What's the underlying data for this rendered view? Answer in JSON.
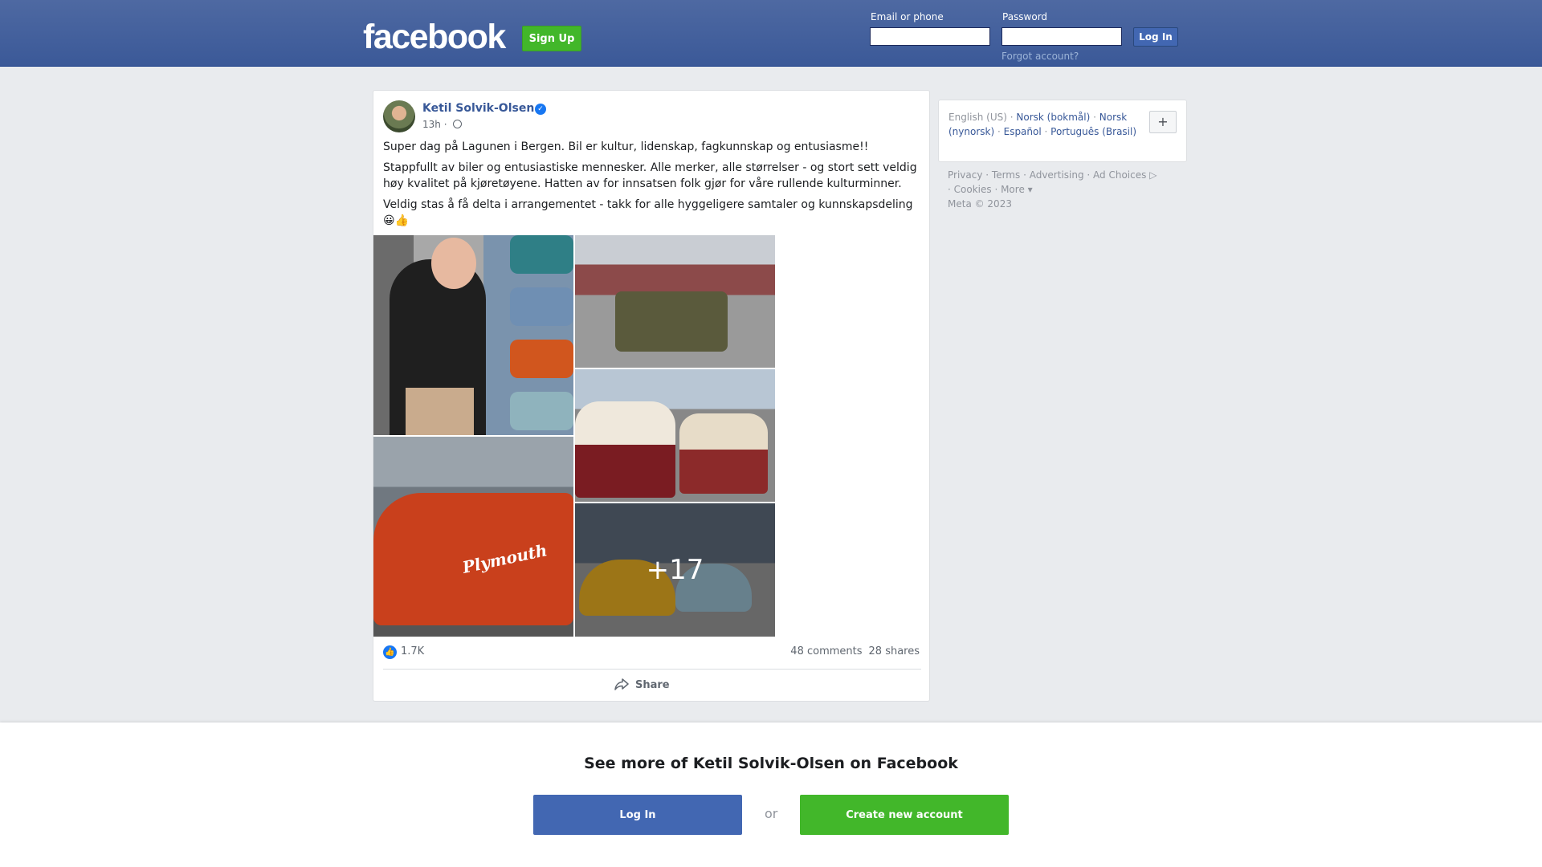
{
  "header": {
    "logo": "facebook",
    "signup_label": "Sign Up",
    "email_label": "Email or phone",
    "password_label": "Password",
    "login_label": "Log In",
    "forgot_label": "Forgot account?"
  },
  "post": {
    "author": "Ketil Solvik-Olsen",
    "time": "13h",
    "privacy_icon": "globe-icon",
    "paragraphs": [
      "Super dag på Lagunen i Bergen. Bil er kultur, lidenskap, fagkunnskap og entusiasme!!",
      "Stappfullt av biler og entusiastiske mennesker. Alle merker, alle størrelser - og stort sett veldig høy kvalitet på kjøretøyene. Hatten av for innsatsen folk gjør for våre rullende kulturminner.",
      "Veldig stas å få delta i arrangementet - takk for alle hyggeligere samtaler og kunnskapsdeling 😀👍"
    ],
    "photo_car_text": "Plymouth",
    "more_photos": "+17",
    "likes": "1.7K",
    "comments": "48 comments",
    "shares": "28 shares",
    "share_label": "Share"
  },
  "sidebar": {
    "languages": [
      "English (US)",
      "Norsk (bokmål)",
      "Norsk (nynorsk)",
      "Español",
      "Português (Brasil)"
    ],
    "footer_links": [
      "Privacy",
      "Terms",
      "Advertising",
      "Ad Choices",
      "Cookies",
      "More"
    ],
    "copyright": "Meta © 2023"
  },
  "bottom": {
    "title": "See more of Ketil Solvik-Olsen on Facebook",
    "login_label": "Log In",
    "or_label": "or",
    "create_label": "Create new account"
  },
  "colors": {
    "brand_blue": "#3b5998",
    "link_blue": "#385898",
    "green": "#42b72a",
    "background": "#e9ebee"
  }
}
